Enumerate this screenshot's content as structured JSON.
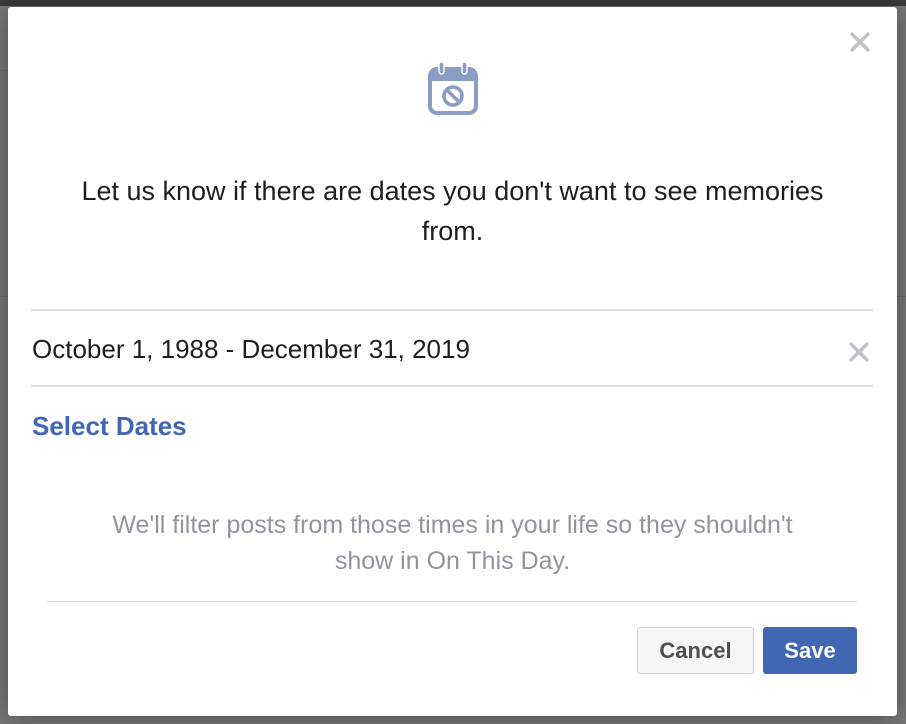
{
  "dialog": {
    "icon": "calendar-blocked-icon",
    "headline": "Let us know if there are dates you don't want to see memories from.",
    "date_range": "October 1, 1988 - December 31, 2019",
    "select_dates_label": "Select Dates",
    "note": "We'll filter posts from those times in your life so they shouldn't show in On This Day.",
    "cancel_label": "Cancel",
    "save_label": "Save"
  },
  "colors": {
    "accent": "#4267b2",
    "headline_text": "#1c1e21",
    "muted_text": "#90949c",
    "icon": "#8b9dc3",
    "close_icon": "#bec3c9",
    "divider": "#dadde1"
  }
}
